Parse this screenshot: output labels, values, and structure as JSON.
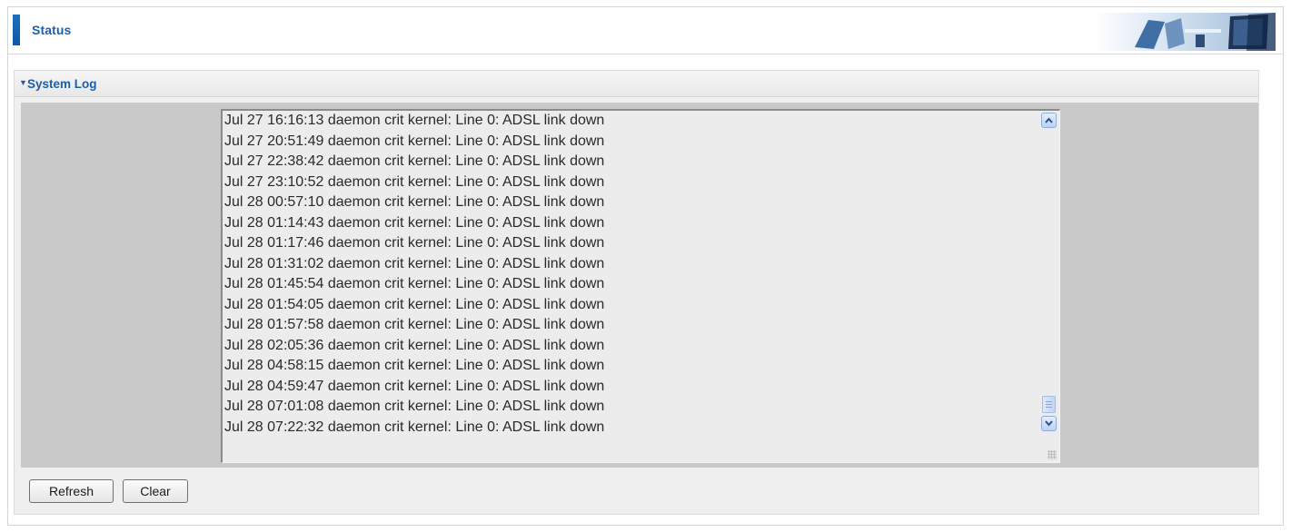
{
  "header": {
    "title": "Status"
  },
  "section": {
    "title": "System Log"
  },
  "log": {
    "lines": [
      "Jul 27 16:16:13 daemon crit kernel: Line 0: ADSL link down",
      "Jul 27 20:51:49 daemon crit kernel: Line 0: ADSL link down",
      "Jul 27 22:38:42 daemon crit kernel: Line 0: ADSL link down",
      "Jul 27 23:10:52 daemon crit kernel: Line 0: ADSL link down",
      "Jul 28 00:57:10 daemon crit kernel: Line 0: ADSL link down",
      "Jul 28 01:14:43 daemon crit kernel: Line 0: ADSL link down",
      "Jul 28 01:17:46 daemon crit kernel: Line 0: ADSL link down",
      "Jul 28 01:31:02 daemon crit kernel: Line 0: ADSL link down",
      "Jul 28 01:45:54 daemon crit kernel: Line 0: ADSL link down",
      "Jul 28 01:54:05 daemon crit kernel: Line 0: ADSL link down",
      "Jul 28 01:57:58 daemon crit kernel: Line 0: ADSL link down",
      "Jul 28 02:05:36 daemon crit kernel: Line 0: ADSL link down",
      "Jul 28 04:58:15 daemon crit kernel: Line 0: ADSL link down",
      "Jul 28 04:59:47 daemon crit kernel: Line 0: ADSL link down",
      "Jul 28 07:01:08 daemon crit kernel: Line 0: ADSL link down",
      "Jul 28 07:22:32 daemon crit kernel: Line 0: ADSL link down"
    ]
  },
  "buttons": {
    "refresh_label": "Refresh",
    "clear_label": "Clear"
  },
  "icons": {
    "section_toggle": "triangle-down-icon",
    "scroll_up": "chevron-up-icon",
    "scroll_down": "chevron-down-icon",
    "header_art": "office-computer-banner"
  },
  "colors": {
    "accent": "#1b5fa8",
    "panel_background": "#efefef",
    "log_area_background": "#c9c9c9"
  },
  "scroll": {
    "position_fraction": 0.97
  }
}
